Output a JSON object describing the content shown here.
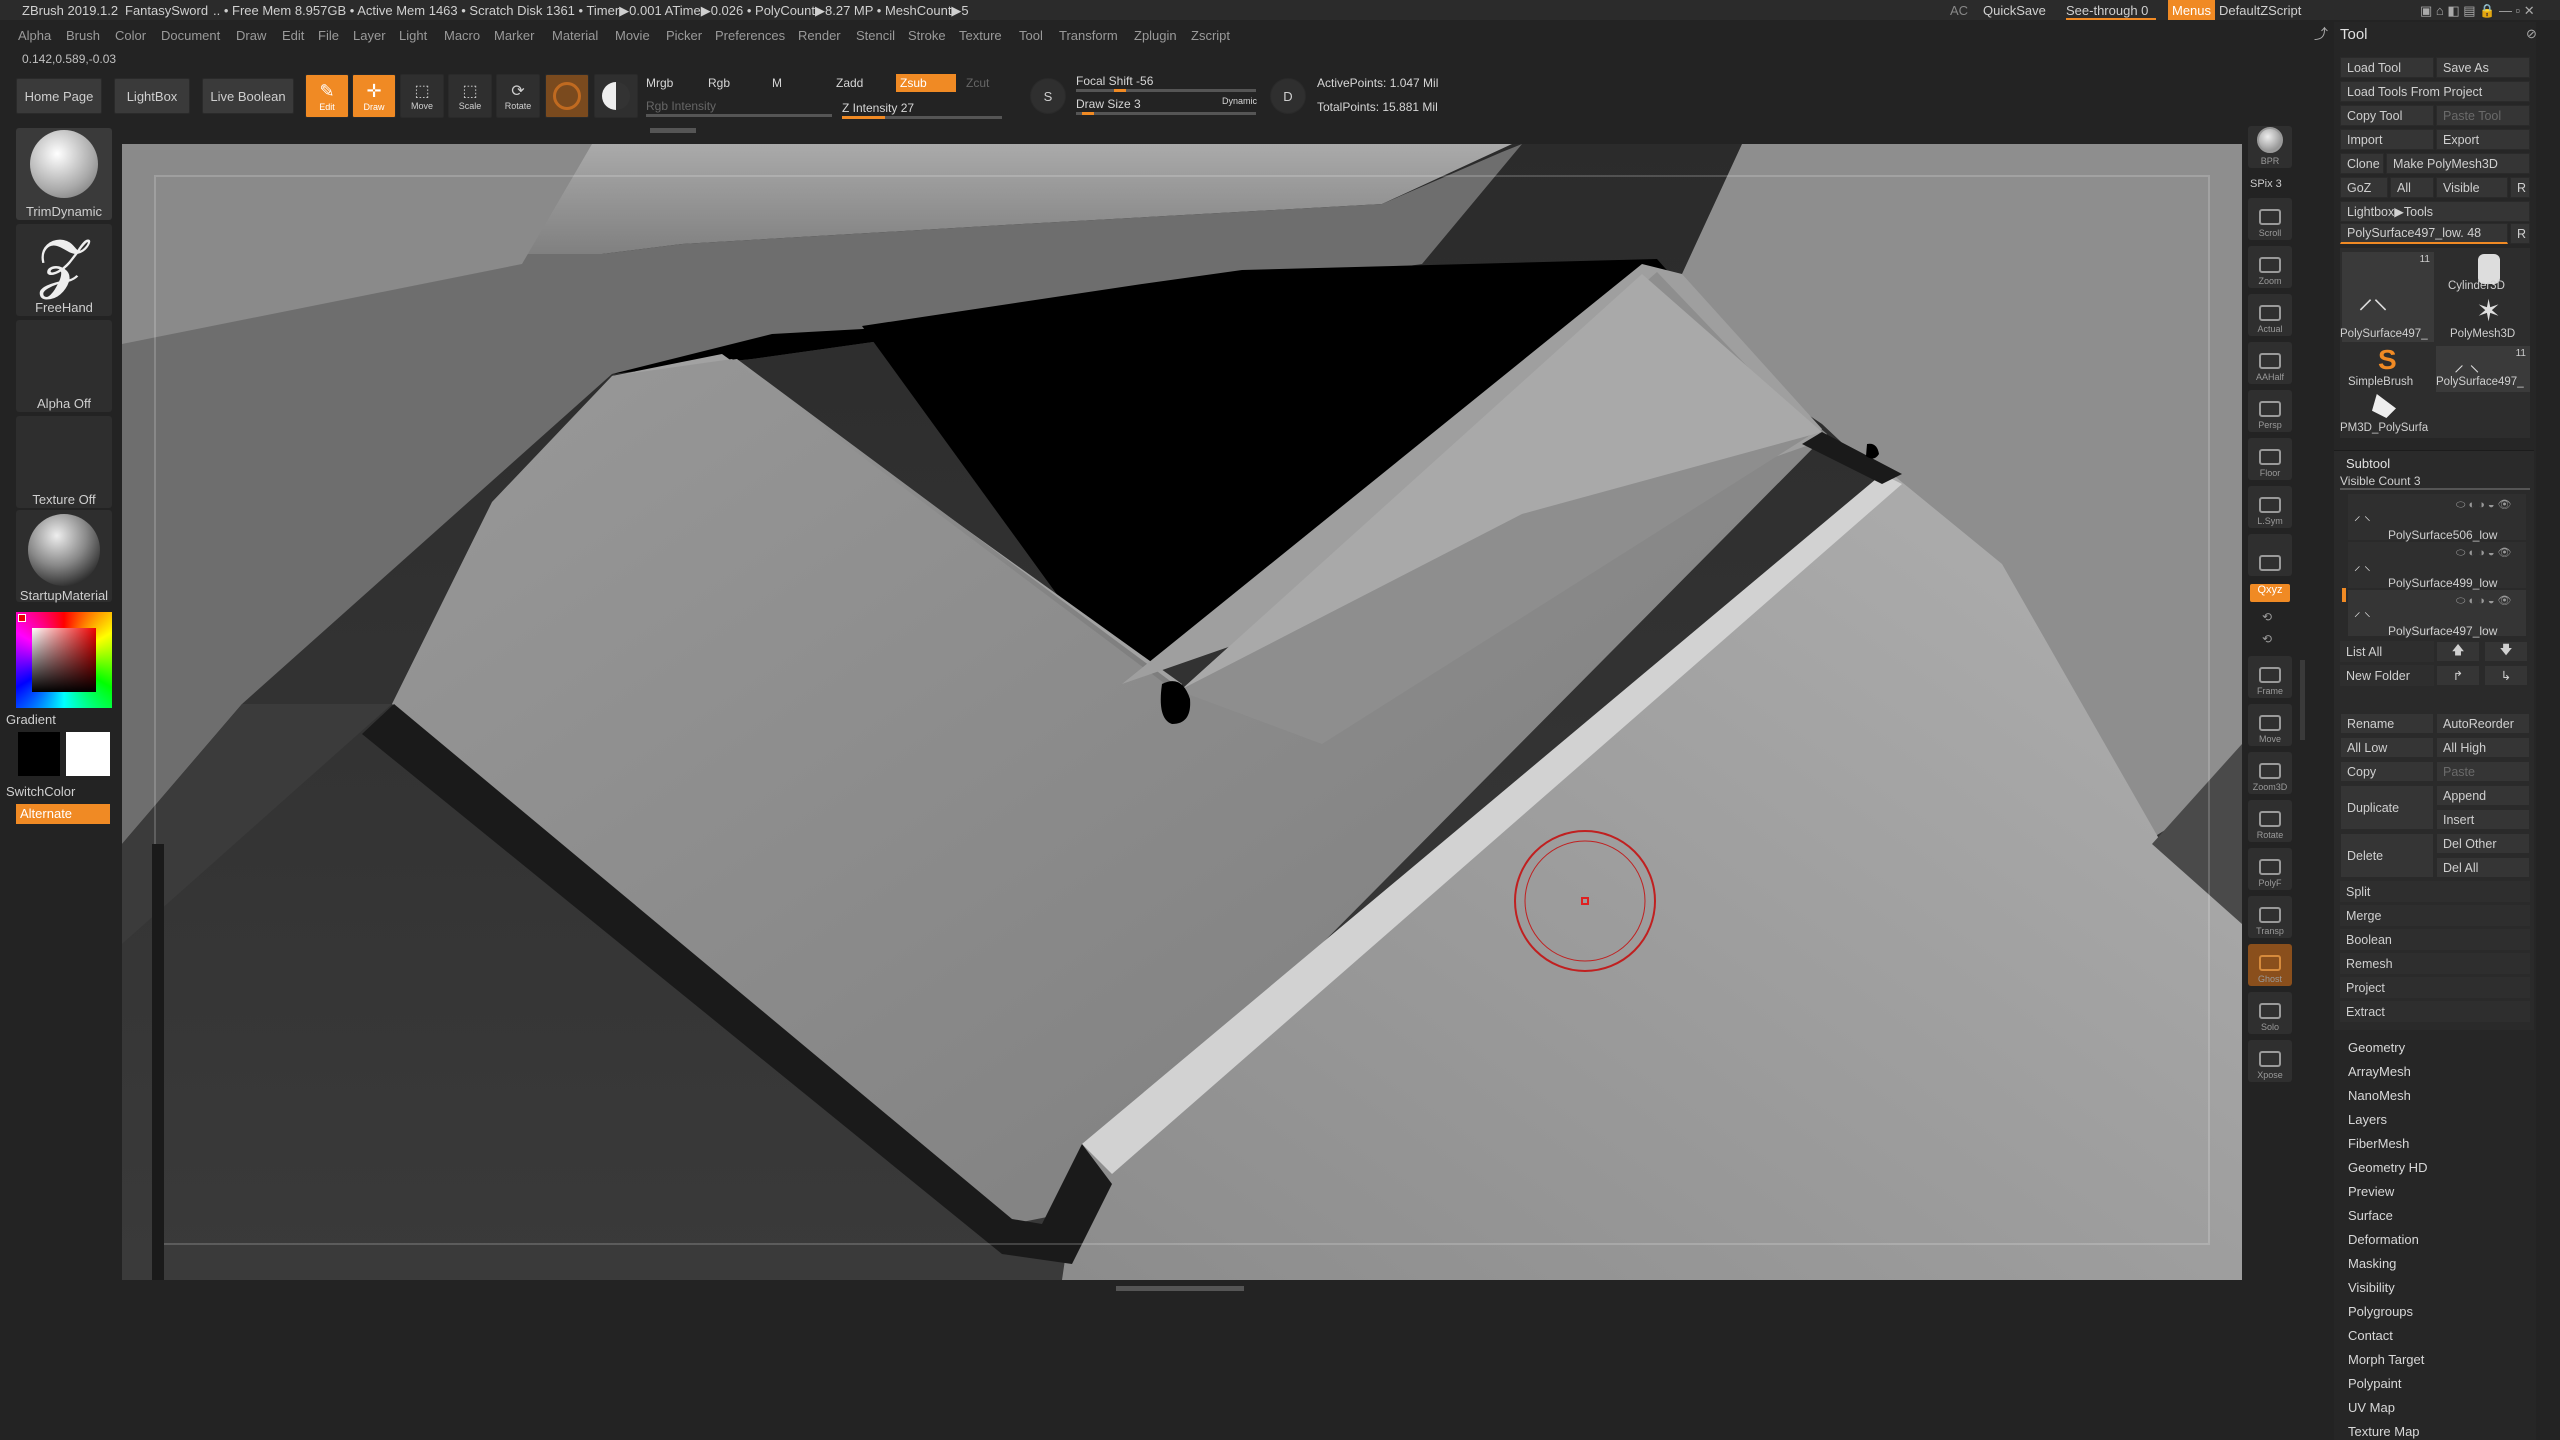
{
  "titlebar": {
    "app": "ZBrush 2019.1.2",
    "project": "FantasySword",
    "stats": ".. • Free Mem 8.957GB • Active Mem 1463 • Scratch Disk 1361 •  Timer▶0.001 ATime▶0.026 • PolyCount▶8.27 MP  • MeshCount▶5",
    "ac": "AC",
    "quicksave": "QuickSave",
    "seethrough": "See-through  0",
    "menus": "Menus",
    "script": "DefaultZScript"
  },
  "menubar": [
    "Alpha",
    "Brush",
    "Color",
    "Document",
    "Draw",
    "Edit",
    "File",
    "Layer",
    "Light",
    "Macro",
    "Marker",
    "Material",
    "Movie",
    "Picker",
    "Preferences",
    "Render",
    "Stencil",
    "Stroke",
    "Texture",
    "Tool",
    "Transform",
    "Zplugin",
    "Zscript"
  ],
  "coords": "0.142,0.589,-0.03",
  "toolbar": {
    "home": "Home Page",
    "lightbox": "LightBox",
    "liveboolean": "Live Boolean",
    "edit": "Edit",
    "draw": "Draw",
    "move": "Move",
    "scale": "Scale",
    "rotate": "Rotate",
    "mrgb": "Mrgb",
    "rgb": "Rgb",
    "m": "M",
    "rgb_intensity": "Rgb Intensity",
    "zadd": "Zadd",
    "zsub": "Zsub",
    "zcut": "Zcut",
    "z_intensity": "Z Intensity 27",
    "z_intensity_value": 0.27,
    "focal_shift": "Focal Shift -56",
    "draw_size": "Draw Size 3",
    "dynamic": "Dynamic",
    "active_points": "ActivePoints: 1.047 Mil",
    "total_points": "TotalPoints: 15.881 Mil"
  },
  "left_tray": {
    "brush": "TrimDynamic",
    "stroke": "FreeHand",
    "alpha": "Alpha Off",
    "texture": "Texture Off",
    "material": "StartupMaterial",
    "gradient": "Gradient",
    "switchcolor": "SwitchColor",
    "alternate": "Alternate"
  },
  "right_shelf": [
    "BPR",
    "SPix 3",
    "Scroll",
    "Zoom",
    "Actual",
    "AAHalf",
    "Persp",
    "Floor",
    "L.Sym",
    "",
    "Qxyz",
    "",
    "",
    "Frame",
    "Move",
    "Zoom3D",
    "Rotate",
    "PolyF",
    "Transp",
    "Ghost",
    "Solo",
    "Xpose"
  ],
  "tool_panel": {
    "title": "Tool",
    "load_tool": "Load Tool",
    "save_as": "Save As",
    "load_from_project": "Load Tools From Project",
    "copy_tool": "Copy Tool",
    "paste_tool": "Paste Tool",
    "import": "Import",
    "export": "Export",
    "clone": "Clone",
    "make_polymesh": "Make PolyMesh3D",
    "goz": "GoZ",
    "all": "All",
    "visible": "Visible",
    "r": "R",
    "lightbox_tools": "Lightbox▶Tools",
    "current_tool": "PolySurface497_low. 48",
    "thumbs": [
      "PolySurface497_",
      "Cylinder3D",
      "PolyMesh3D",
      "SimpleBrush",
      "PolySurface497_",
      "PM3D_PolySurfa"
    ],
    "thumb_counts": [
      "11",
      "11"
    ],
    "subtool": "Subtool",
    "visible_count": "Visible Count 3",
    "subtools": [
      "PolySurface506_low",
      "PolySurface499_low",
      "PolySurface497_low"
    ],
    "list_all": "List All",
    "new_folder": "New Folder",
    "rename": "Rename",
    "autoreorder": "AutoReorder",
    "all_low": "All Low",
    "all_high": "All High",
    "copy": "Copy",
    "paste": "Paste",
    "duplicate": "Duplicate",
    "append": "Append",
    "insert": "Insert",
    "delete": "Delete",
    "del_other": "Del Other",
    "del_all": "Del All",
    "actions": [
      "Split",
      "Merge",
      "Boolean",
      "Remesh",
      "Project",
      "Extract"
    ],
    "sections": [
      "Geometry",
      "ArrayMesh",
      "NanoMesh",
      "Layers",
      "FiberMesh",
      "Geometry HD",
      "Preview",
      "Surface",
      "Deformation",
      "Masking",
      "Visibility",
      "Polygroups",
      "Contact",
      "Morph Target",
      "Polypaint",
      "UV Map",
      "Texture Map"
    ]
  }
}
